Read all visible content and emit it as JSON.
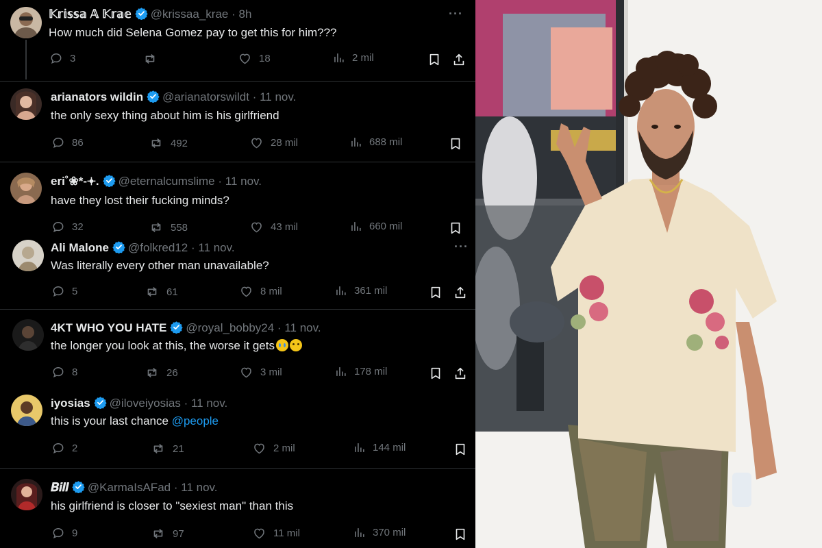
{
  "tweets": [
    {
      "name": "𝕂𝕣𝕚𝕤𝕤𝕒 𝔸 𝕂𝕣𝕒𝕖",
      "handle": "@krissaa_krae",
      "time": "8h",
      "text": "How much did Selena Gomez pay to get this for him???",
      "replies": "3",
      "reposts": "",
      "likes": "18",
      "views": "2 mil"
    },
    {
      "name": "arianators wildin",
      "handle": "@arianatorswildt",
      "time": "11 nov.",
      "text": "the only sexy thing about him is his girlfriend",
      "replies": "86",
      "reposts": "492",
      "likes": "28 mil",
      "views": "688 mil"
    },
    {
      "name": "eri˚❀*-𖥔.",
      "handle": "@eternalcumslime",
      "time": "11 nov.",
      "text": "have they lost their fucking minds?",
      "replies": "32",
      "reposts": "558",
      "likes": "43 mil",
      "views": "660 mil"
    },
    {
      "name": "Ali Malone",
      "handle": "@folkred12",
      "time": "11 nov.",
      "text": "Was literally every other man unavailable?",
      "replies": "5",
      "reposts": "61",
      "likes": "8 mil",
      "views": "361 mil"
    },
    {
      "name": "4KT WHO YOU HATE",
      "handle": "@royal_bobby24",
      "time": "11 nov.",
      "text": "the longer you look at this, the worse it gets",
      "replies": "8",
      "reposts": "26",
      "likes": "3 mil",
      "views": "178 mil"
    },
    {
      "name": "iyosias",
      "handle": "@iloveiyosias",
      "time": "11 nov.",
      "text": "this is your last chance",
      "mention": "@people",
      "replies": "2",
      "reposts": "21",
      "likes": "2 mil",
      "views": "144 mil"
    },
    {
      "name": "𝑩𝒊𝒍𝒍",
      "handle": "@KarmaIsAFad",
      "time": "11 nov.",
      "text": "his girlfriend is closer to \"sexiest man\" than this",
      "replies": "9",
      "reposts": "97",
      "likes": "11 mil",
      "views": "370 mil"
    }
  ],
  "separator": "·",
  "more_glyph": "···",
  "icons": [
    "reply-icon",
    "repost-icon",
    "like-icon",
    "views-icon",
    "bookmark-icon",
    "share-icon",
    "verified-badge-icon",
    "more-icon"
  ],
  "colors": {
    "background": "#000000",
    "text": "#e7e9ea",
    "muted": "#71767b",
    "verified": "#1d9bf0",
    "link": "#1d9bf0",
    "divider": "#2f3336"
  }
}
